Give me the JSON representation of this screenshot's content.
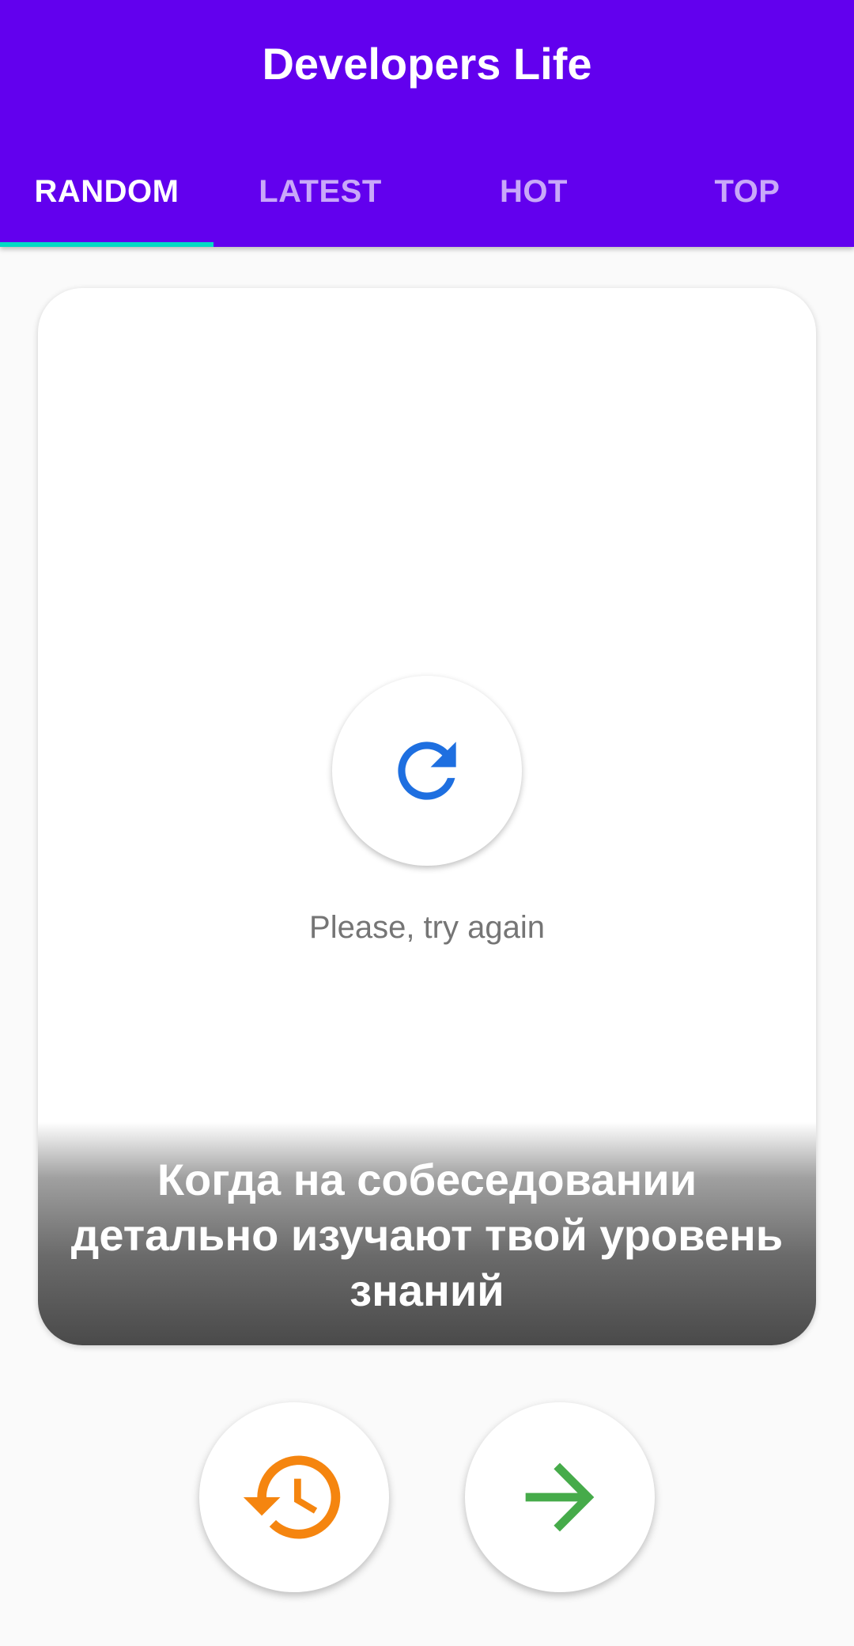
{
  "app_bar": {
    "title": "Developers Life",
    "background_color": "#6200ee",
    "tabs": [
      {
        "label": "RANDOM",
        "active": true
      },
      {
        "label": "LATEST",
        "active": false
      },
      {
        "label": "HOT",
        "active": false
      },
      {
        "label": "TOP",
        "active": false
      }
    ],
    "indicator_color": "#03dac5"
  },
  "card": {
    "error_icon": "refresh-icon",
    "error_icon_color": "#1e6fe0",
    "error_message": "Please, try again",
    "caption": "Когда на собеседовании детально изучают твой уровень знаний"
  },
  "actions": {
    "back": {
      "icon": "history-icon",
      "color": "#f5850f"
    },
    "next": {
      "icon": "arrow-right-icon",
      "color": "#46ab4a"
    }
  }
}
